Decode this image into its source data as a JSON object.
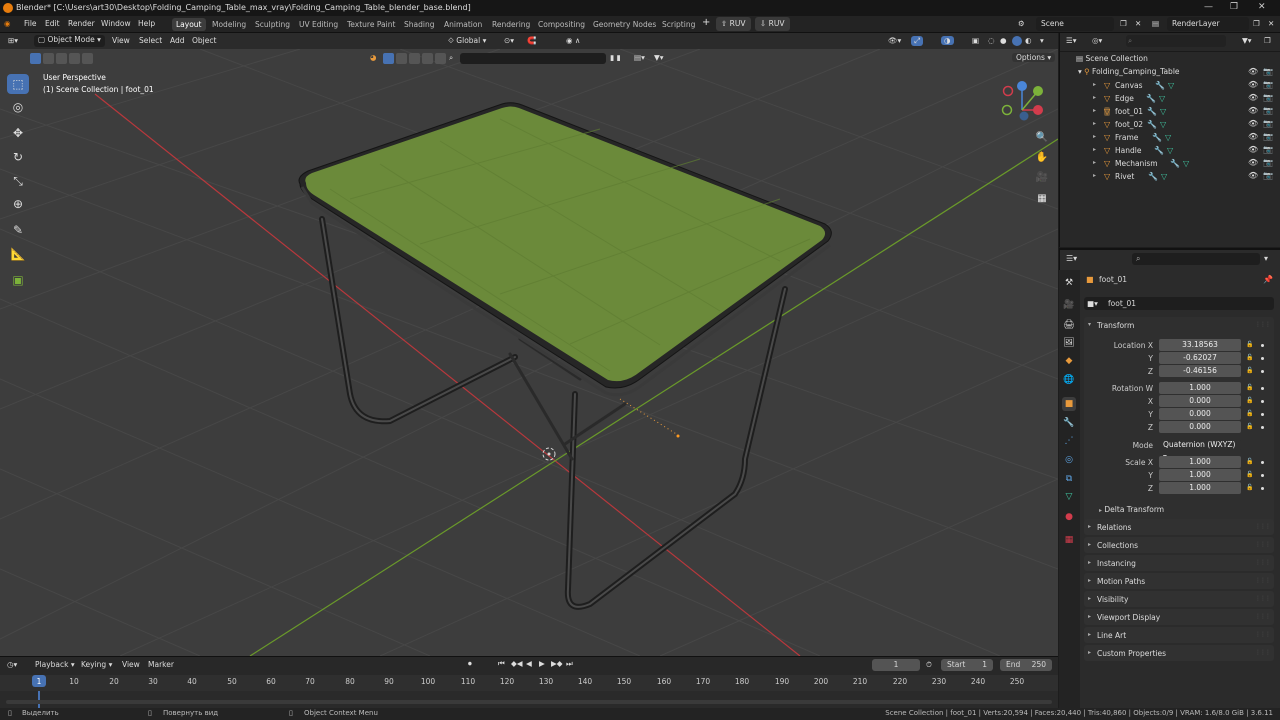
{
  "title": "Blender* [C:\\Users\\art30\\Desktop\\Folding_Camping_Table_max_vray\\Folding_Camping_Table_blender_base.blend]",
  "menu": [
    "File",
    "Edit",
    "Render",
    "Window",
    "Help"
  ],
  "workspaces": [
    "Layout",
    "Modeling",
    "Sculpting",
    "UV Editing",
    "Texture Paint",
    "Shading",
    "Animation",
    "Rendering",
    "Compositing",
    "Geometry Nodes",
    "Scripting"
  ],
  "active_workspace": "Layout",
  "ruv_buttons": [
    "RUV",
    "RUV"
  ],
  "scene": "Scene",
  "render_layer": "RenderLayer",
  "viewport_header": {
    "mode": "Object Mode",
    "view": "View",
    "select": "Select",
    "add": "Add",
    "object": "Object",
    "orientation": "Global",
    "options": "Options"
  },
  "overlay_text": {
    "perspective": "User Perspective",
    "collection": "(1) Scene Collection | foot_01"
  },
  "outliner": {
    "root": "Scene Collection",
    "collection": "Folding_Camping_Table",
    "items": [
      "Canvas",
      "Edge",
      "foot_01",
      "foot_02",
      "Frame",
      "Handle",
      "Mechanism",
      "Rivet"
    ]
  },
  "properties": {
    "object_name": "foot_01",
    "data_name": "foot_01",
    "transform_title": "Transform",
    "location_label": "Location X",
    "location": [
      "33.18563",
      "-0.62027",
      "-0.46156"
    ],
    "rotation_label": "Rotation W",
    "rotation": [
      "1.000",
      "0.000",
      "0.000",
      "0.000"
    ],
    "mode_label": "Mode",
    "mode_value": "Quaternion (WXYZ)",
    "scale_label": "Scale X",
    "scale": [
      "1.000",
      "1.000",
      "1.000"
    ],
    "axis_labels": [
      "X",
      "Y",
      "Z"
    ],
    "delta": "Delta Transform",
    "panels": [
      "Relations",
      "Collections",
      "Instancing",
      "Motion Paths",
      "Visibility",
      "Viewport Display",
      "Line Art",
      "Custom Properties"
    ]
  },
  "timeline": {
    "menus": [
      "Playback",
      "Keying",
      "View",
      "Marker"
    ],
    "current_frame": "1",
    "start_label": "Start",
    "start": "1",
    "end_label": "End",
    "end": "250",
    "ticks": [
      "1",
      "10",
      "20",
      "30",
      "40",
      "50",
      "60",
      "70",
      "80",
      "90",
      "100",
      "110",
      "120",
      "130",
      "140",
      "150",
      "160",
      "170",
      "180",
      "190",
      "200",
      "210",
      "220",
      "230",
      "240",
      "250"
    ]
  },
  "status": {
    "left1": "Выделить",
    "left2": "Повернуть вид",
    "left3": "Object Context Menu",
    "right": "Scene Collection | foot_01 | Verts:20,594 | Faces:20,440 | Tris:40,860 | Objects:0/9 | VRAM: 1.6/8.0 GiB | 3.6.11"
  },
  "colors": {
    "accent": "#4772b3",
    "tabletop": "#6b8a3a",
    "frame": "#2a2a2a",
    "grid": "#484848",
    "x_axis": "#b8383c",
    "y_axis": "#6a9a2a"
  }
}
